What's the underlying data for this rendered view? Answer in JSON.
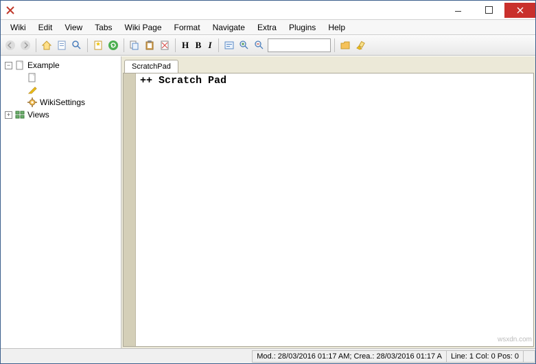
{
  "window": {
    "title": ""
  },
  "menu": {
    "items": [
      "Wiki",
      "Edit",
      "View",
      "Tabs",
      "Wiki Page",
      "Format",
      "Navigate",
      "Extra",
      "Plugins",
      "Help"
    ]
  },
  "tree": {
    "items": [
      {
        "label": "Example",
        "icon": "page",
        "expander": "-",
        "level": 0
      },
      {
        "label": "",
        "icon": "page",
        "expander": "none",
        "level": 1
      },
      {
        "label": "",
        "icon": "pencil",
        "expander": "none",
        "level": 1
      },
      {
        "label": "WikiSettings",
        "icon": "gear",
        "expander": "none",
        "level": 1
      },
      {
        "label": "Views",
        "icon": "views",
        "expander": "+",
        "level": 0
      }
    ]
  },
  "tabs": {
    "active": "ScratchPad"
  },
  "editor": {
    "content": "++ Scratch Pad"
  },
  "toolbar": {
    "search_value": "",
    "h_label": "H",
    "b_label": "B",
    "i_label": "I"
  },
  "status": {
    "mod": "Mod.: 28/03/2016 01:17 AM; Crea.: 28/03/2016 01:17 A",
    "pos": "Line: 1 Col: 0 Pos: 0"
  },
  "watermark": "wsxdn.com"
}
